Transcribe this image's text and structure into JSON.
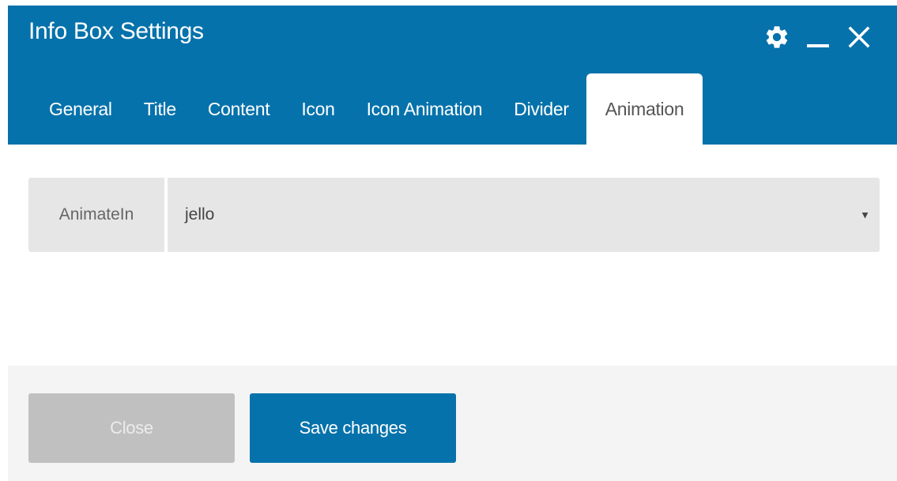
{
  "dialog": {
    "title": "Info Box Settings",
    "controls": {
      "settings_icon": "gear-icon",
      "minimize_icon": "minimize-icon",
      "close_icon": "close-icon"
    }
  },
  "tabs": [
    {
      "label": "General",
      "active": false
    },
    {
      "label": "Title",
      "active": false
    },
    {
      "label": "Content",
      "active": false
    },
    {
      "label": "Icon",
      "active": false
    },
    {
      "label": "Icon Animation",
      "active": false
    },
    {
      "label": "Divider",
      "active": false
    },
    {
      "label": "Animation",
      "active": true
    }
  ],
  "animation_field": {
    "label": "AnimateIn",
    "value": "jello",
    "caret": "▼"
  },
  "footer": {
    "close_label": "Close",
    "save_label": "Save changes"
  },
  "colors": {
    "primary": "#0672ab",
    "disabled_button": "#c0c0c0",
    "field_background": "#e6e6e6",
    "footer_background": "#f4f4f4"
  }
}
